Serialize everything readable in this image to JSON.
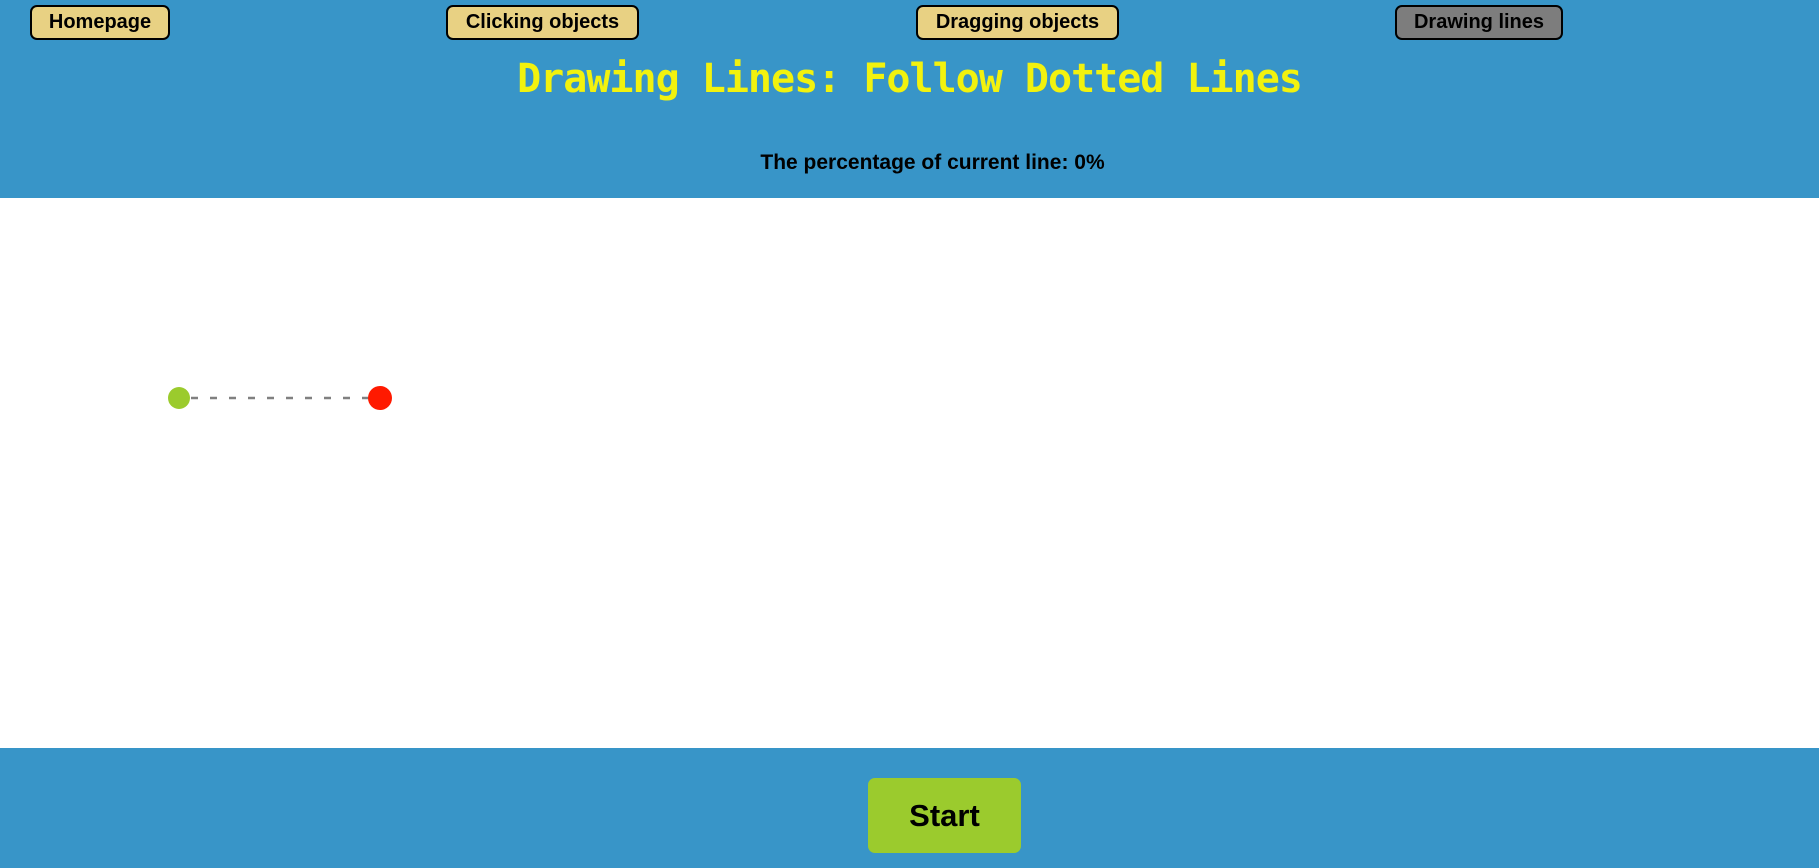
{
  "nav": {
    "homepage": "Homepage",
    "clicking": "Clicking objects",
    "dragging": "Dragging objects",
    "drawing": "Drawing lines",
    "active": "drawing"
  },
  "title": "Drawing Lines: Follow Dotted Lines",
  "status": {
    "text": "The percentage of current line: 0%",
    "percentage": 0
  },
  "drawing": {
    "start_point_color": "#9bcb2d",
    "end_point_color": "#ff1a00",
    "line_color": "#808080",
    "line_style": "dashed"
  },
  "footer": {
    "start_label": "Start"
  },
  "colors": {
    "header_bg": "#3895c8",
    "title": "#f2f20e",
    "nav_button": "#e8d183",
    "nav_active": "#7d7d7d",
    "start_button": "#9bcb2d"
  }
}
